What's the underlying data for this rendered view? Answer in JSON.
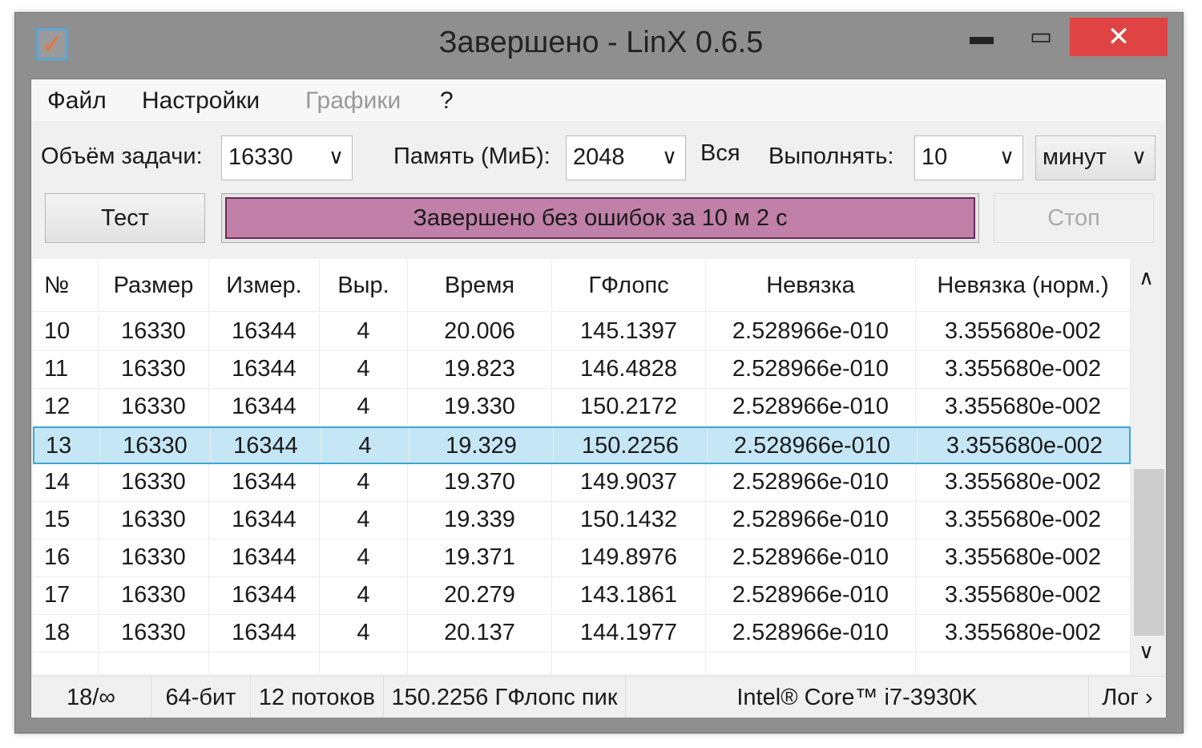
{
  "window": {
    "title": "Завершено - LinX 0.6.5",
    "minimize": "▬",
    "maximize": "▭",
    "close": "✕",
    "icon": "✓"
  },
  "menu": [
    "Файл",
    "Настройки",
    "Графики",
    "?"
  ],
  "controls": {
    "size_label": "Объём задачи:",
    "size_value": "16330",
    "memory_label": "Память (МиБ):",
    "memory_value": "2048",
    "memory_all": "Вся",
    "run_label": "Выполнять:",
    "run_value": "10",
    "run_unit": "минут",
    "arrow": "∨"
  },
  "buttons": {
    "test": "Тест",
    "stop": "Стоп"
  },
  "progress": {
    "text": "Завершено без ошибок за 10 м 2 с",
    "fraction": 1.0,
    "color": "#c080a8"
  },
  "table": {
    "headers": [
      "№",
      "Размер",
      "Измер.",
      "Выр.",
      "Время",
      "ГФлопс",
      "Невязка",
      "Невязка (норм.)"
    ],
    "rows": [
      [
        "10",
        "16330",
        "16344",
        "4",
        "20.006",
        "145.1397",
        "2.528966e-010",
        "3.355680e-002"
      ],
      [
        "11",
        "16330",
        "16344",
        "4",
        "19.823",
        "146.4828",
        "2.528966e-010",
        "3.355680e-002"
      ],
      [
        "12",
        "16330",
        "16344",
        "4",
        "19.330",
        "150.2172",
        "2.528966e-010",
        "3.355680e-002"
      ],
      [
        "13",
        "16330",
        "16344",
        "4",
        "19.329",
        "150.2256",
        "2.528966e-010",
        "3.355680e-002"
      ],
      [
        "14",
        "16330",
        "16344",
        "4",
        "19.370",
        "149.9037",
        "2.528966e-010",
        "3.355680e-002"
      ],
      [
        "15",
        "16330",
        "16344",
        "4",
        "19.339",
        "150.1432",
        "2.528966e-010",
        "3.355680e-002"
      ],
      [
        "16",
        "16330",
        "16344",
        "4",
        "19.371",
        "149.8976",
        "2.528966e-010",
        "3.355680e-002"
      ],
      [
        "17",
        "16330",
        "16344",
        "4",
        "20.279",
        "143.1861",
        "2.528966e-010",
        "3.355680e-002"
      ],
      [
        "18",
        "16330",
        "16344",
        "4",
        "20.137",
        "144.1977",
        "2.528966e-010",
        "3.355680e-002"
      ]
    ],
    "selected": "13",
    "scroll_up": "∧",
    "scroll_down": "∨"
  },
  "status": {
    "count": "18/∞",
    "bits": "64-бит",
    "threads": "12 потоков",
    "peak": "150.2256 ГФлопс пик",
    "cpu": "Intel® Core™ i7-3930K",
    "log": "Лог ›"
  }
}
